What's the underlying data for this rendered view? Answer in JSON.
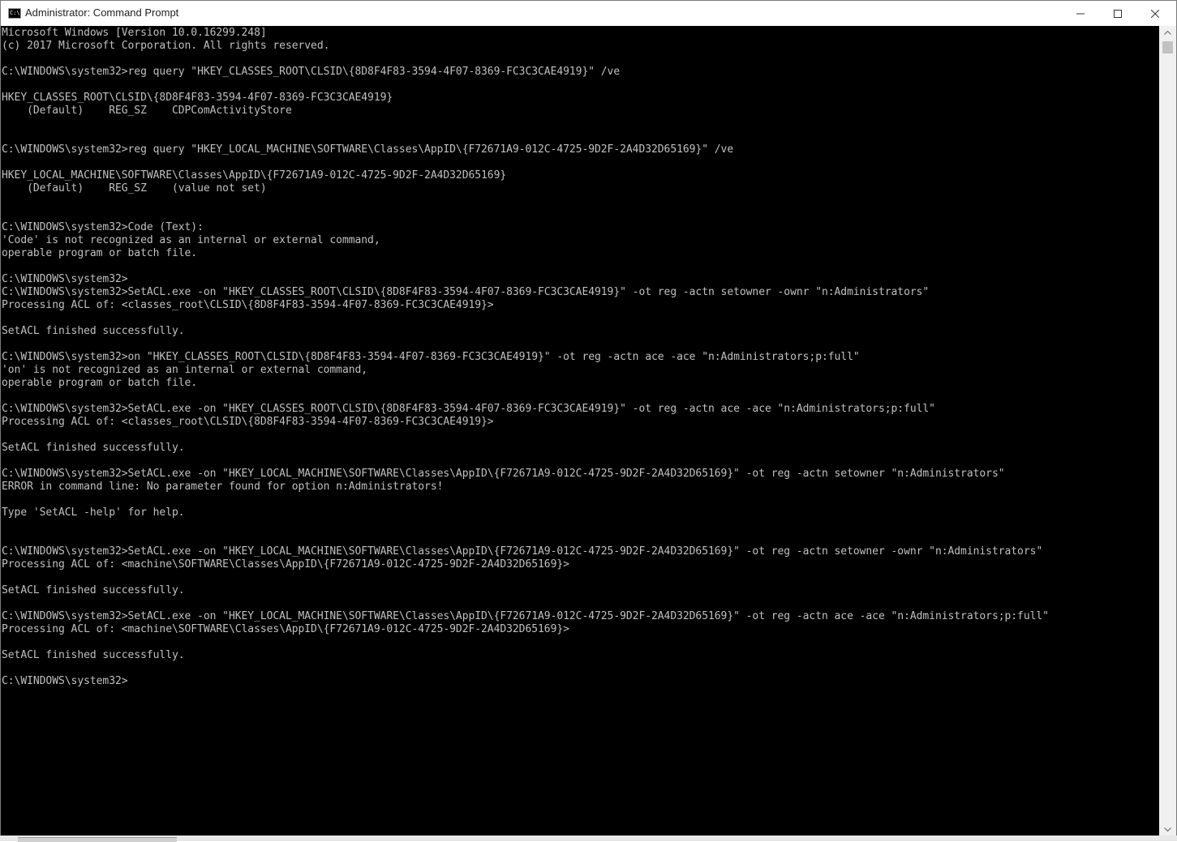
{
  "window": {
    "title": "Administrator: Command Prompt",
    "icon": "console-icon",
    "icon_glyph": "C:\\",
    "controls": {
      "minimize": "minimize-icon",
      "maximize": "maximize-icon",
      "close": "close-icon"
    }
  },
  "console": {
    "lines": [
      "Microsoft Windows [Version 10.0.16299.248]",
      "(c) 2017 Microsoft Corporation. All rights reserved.",
      "",
      "C:\\WINDOWS\\system32>reg query \"HKEY_CLASSES_ROOT\\CLSID\\{8D8F4F83-3594-4F07-8369-FC3C3CAE4919}\" /ve",
      "",
      "HKEY_CLASSES_ROOT\\CLSID\\{8D8F4F83-3594-4F07-8369-FC3C3CAE4919}",
      "    (Default)    REG_SZ    CDPComActivityStore",
      "",
      "",
      "C:\\WINDOWS\\system32>reg query \"HKEY_LOCAL_MACHINE\\SOFTWARE\\Classes\\AppID\\{F72671A9-012C-4725-9D2F-2A4D32D65169}\" /ve",
      "",
      "HKEY_LOCAL_MACHINE\\SOFTWARE\\Classes\\AppID\\{F72671A9-012C-4725-9D2F-2A4D32D65169}",
      "    (Default)    REG_SZ    (value not set)",
      "",
      "",
      "C:\\WINDOWS\\system32>Code (Text):",
      "'Code' is not recognized as an internal or external command,",
      "operable program or batch file.",
      "",
      "C:\\WINDOWS\\system32>",
      "C:\\WINDOWS\\system32>SetACL.exe -on \"HKEY_CLASSES_ROOT\\CLSID\\{8D8F4F83-3594-4F07-8369-FC3C3CAE4919}\" -ot reg -actn setowner -ownr \"n:Administrators\"",
      "Processing ACL of: <classes_root\\CLSID\\{8D8F4F83-3594-4F07-8369-FC3C3CAE4919}>",
      "",
      "SetACL finished successfully.",
      "",
      "C:\\WINDOWS\\system32>on \"HKEY_CLASSES_ROOT\\CLSID\\{8D8F4F83-3594-4F07-8369-FC3C3CAE4919}\" -ot reg -actn ace -ace \"n:Administrators;p:full\"",
      "'on' is not recognized as an internal or external command,",
      "operable program or batch file.",
      "",
      "C:\\WINDOWS\\system32>SetACL.exe -on \"HKEY_CLASSES_ROOT\\CLSID\\{8D8F4F83-3594-4F07-8369-FC3C3CAE4919}\" -ot reg -actn ace -ace \"n:Administrators;p:full\"",
      "Processing ACL of: <classes_root\\CLSID\\{8D8F4F83-3594-4F07-8369-FC3C3CAE4919}>",
      "",
      "SetACL finished successfully.",
      "",
      "C:\\WINDOWS\\system32>SetACL.exe -on \"HKEY_LOCAL_MACHINE\\SOFTWARE\\Classes\\AppID\\{F72671A9-012C-4725-9D2F-2A4D32D65169}\" -ot reg -actn setowner \"n:Administrators\"",
      "ERROR in command line: No parameter found for option n:Administrators!",
      "",
      "Type 'SetACL -help' for help.",
      "",
      "",
      "C:\\WINDOWS\\system32>SetACL.exe -on \"HKEY_LOCAL_MACHINE\\SOFTWARE\\Classes\\AppID\\{F72671A9-012C-4725-9D2F-2A4D32D65169}\" -ot reg -actn setowner -ownr \"n:Administrators\"",
      "Processing ACL of: <machine\\SOFTWARE\\Classes\\AppID\\{F72671A9-012C-4725-9D2F-2A4D32D65169}>",
      "",
      "SetACL finished successfully.",
      "",
      "C:\\WINDOWS\\system32>SetACL.exe -on \"HKEY_LOCAL_MACHINE\\SOFTWARE\\Classes\\AppID\\{F72671A9-012C-4725-9D2F-2A4D32D65169}\" -ot reg -actn ace -ace \"n:Administrators;p:full\"",
      "Processing ACL of: <machine\\SOFTWARE\\Classes\\AppID\\{F72671A9-012C-4725-9D2F-2A4D32D65169}>",
      "",
      "SetACL finished successfully.",
      "",
      "C:\\WINDOWS\\system32>"
    ]
  },
  "colors": {
    "console_bg": "#000000",
    "console_fg": "#c0c0c0",
    "titlebar_bg": "#ffffff",
    "scrollbar_bg": "#f0f0f0"
  }
}
